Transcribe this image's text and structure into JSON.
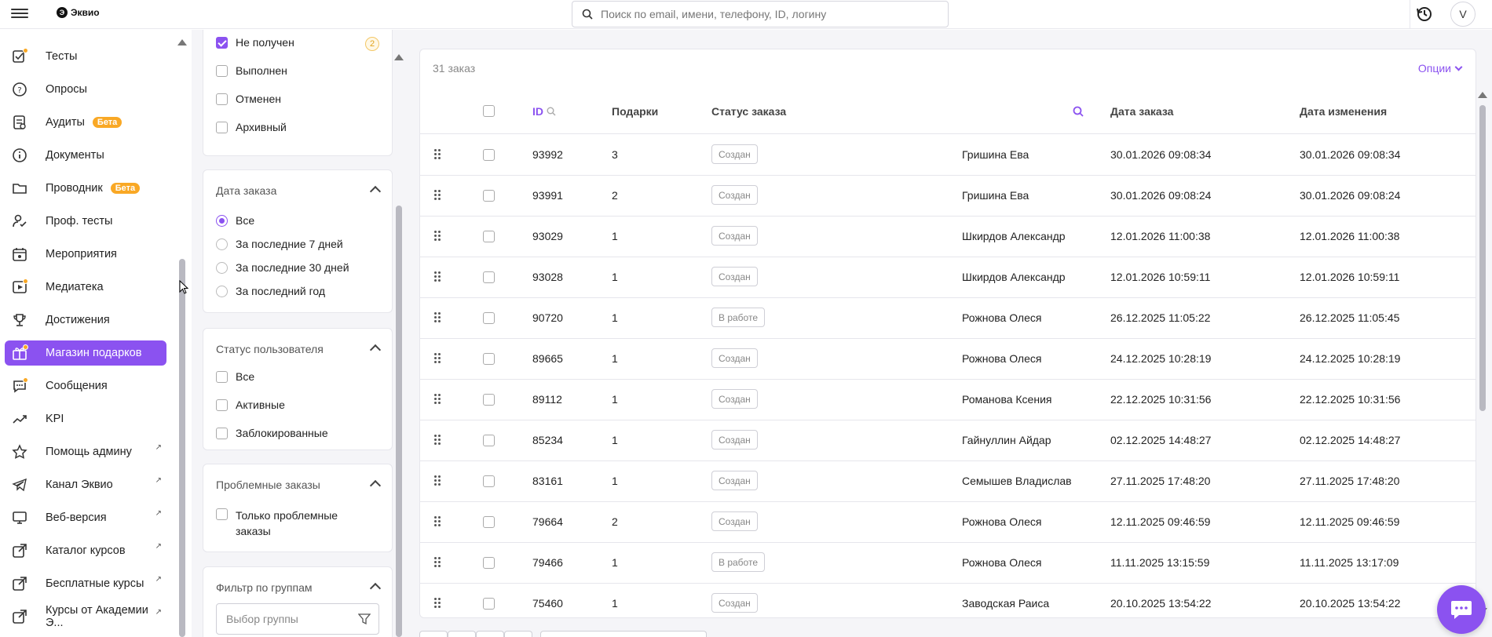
{
  "header": {
    "logo_text": "Эквио",
    "search_placeholder": "Поиск по email, имени, телефону, ID, логину",
    "avatar_letter": "V"
  },
  "sidebar": {
    "items": [
      {
        "label": "Тесты",
        "icon": "test-check-icon",
        "dot": true
      },
      {
        "label": "Опросы",
        "icon": "question-bubble-icon"
      },
      {
        "label": "Аудиты",
        "icon": "audit-clipboard-icon",
        "badge": "Бета"
      },
      {
        "label": "Документы",
        "icon": "info-circle-icon"
      },
      {
        "label": "Проводник",
        "icon": "folder-icon",
        "badge": "Бета"
      },
      {
        "label": "Проф. тесты",
        "icon": "user-check-icon"
      },
      {
        "label": "Мероприятия",
        "icon": "calendar-star-icon"
      },
      {
        "label": "Медиатека",
        "icon": "media-play-icon",
        "dot": true
      },
      {
        "label": "Достижения",
        "icon": "trophy-icon"
      },
      {
        "label": "Магазин подарков",
        "icon": "gift-icon",
        "active": true,
        "dot": true
      },
      {
        "label": "Сообщения",
        "icon": "chat-dots-icon",
        "dot": true
      },
      {
        "label": "KPI",
        "icon": "trend-up-icon"
      },
      {
        "label": "Помощь админу",
        "icon": "star-icon",
        "external": true
      },
      {
        "label": "Канал Эквио",
        "icon": "telegram-icon",
        "external": true
      },
      {
        "label": "Веб-версия",
        "icon": "monitor-icon",
        "external": true
      },
      {
        "label": "Каталог курсов",
        "icon": "external-link-icon",
        "external": true
      },
      {
        "label": "Бесплатные курсы",
        "icon": "external-link-icon",
        "external": true
      },
      {
        "label": "Курсы от Академии Э...",
        "icon": "external-link-icon",
        "external": true
      }
    ]
  },
  "filters": {
    "order_status": {
      "options": [
        {
          "label": "Не получен",
          "checked": true,
          "count": "2"
        },
        {
          "label": "Выполнен",
          "checked": false
        },
        {
          "label": "Отменен",
          "checked": false
        },
        {
          "label": "Архивный",
          "checked": false
        }
      ]
    },
    "order_date": {
      "title": "Дата заказа",
      "options": [
        {
          "label": "Все",
          "checked": true
        },
        {
          "label": "За последние 7 дней",
          "checked": false
        },
        {
          "label": "За последние 30 дней",
          "checked": false
        },
        {
          "label": "За последний год",
          "checked": false
        }
      ]
    },
    "user_status": {
      "title": "Статус пользователя",
      "options": [
        {
          "label": "Все",
          "checked": false
        },
        {
          "label": "Активные",
          "checked": false
        },
        {
          "label": "Заблокированные",
          "checked": false
        }
      ]
    },
    "problem_orders": {
      "title": "Проблемные заказы",
      "option_line1": "Только проблемные",
      "option_line2": "заказы"
    },
    "group_filter": {
      "title": "Фильтр по группам",
      "placeholder": "Выбор группы"
    }
  },
  "table": {
    "count_label": "31 заказ",
    "options_label": "Опции",
    "columns": {
      "id": "ID",
      "gifts": "Подарки",
      "status": "Статус заказа",
      "order_date": "Дата заказа",
      "modified_date": "Дата изменения"
    },
    "rows": [
      {
        "id": "93992",
        "gifts": "3",
        "status": "Создан",
        "user": "Гришина Ева",
        "order_date": "30.01.2026 09:08:34",
        "modified": "30.01.2026 09:08:34"
      },
      {
        "id": "93991",
        "gifts": "2",
        "status": "Создан",
        "user": "Гришина Ева",
        "order_date": "30.01.2026 09:08:24",
        "modified": "30.01.2026 09:08:24"
      },
      {
        "id": "93029",
        "gifts": "1",
        "status": "Создан",
        "user": "Шкирдов Александр",
        "order_date": "12.01.2026 11:00:38",
        "modified": "12.01.2026 11:00:38"
      },
      {
        "id": "93028",
        "gifts": "1",
        "status": "Создан",
        "user": "Шкирдов Александр",
        "order_date": "12.01.2026 10:59:11",
        "modified": "12.01.2026 10:59:11"
      },
      {
        "id": "90720",
        "gifts": "1",
        "status": "В работе",
        "user": "Рожнова Олеся",
        "order_date": "26.12.2025 11:05:22",
        "modified": "26.12.2025 11:05:45"
      },
      {
        "id": "89665",
        "gifts": "1",
        "status": "Создан",
        "user": "Рожнова Олеся",
        "order_date": "24.12.2025 10:28:19",
        "modified": "24.12.2025 10:28:19"
      },
      {
        "id": "89112",
        "gifts": "1",
        "status": "Создан",
        "user": "Романова Ксения",
        "order_date": "22.12.2025 10:31:56",
        "modified": "22.12.2025 10:31:56"
      },
      {
        "id": "85234",
        "gifts": "1",
        "status": "Создан",
        "user": "Гайнуллин Айдар",
        "order_date": "02.12.2025 14:48:27",
        "modified": "02.12.2025 14:48:27"
      },
      {
        "id": "83161",
        "gifts": "1",
        "status": "Создан",
        "user": "Семышев Владислав",
        "order_date": "27.11.2025 17:48:20",
        "modified": "27.11.2025 17:48:20"
      },
      {
        "id": "79664",
        "gifts": "2",
        "status": "Создан",
        "user": "Рожнова Олеся",
        "order_date": "12.11.2025 09:46:59",
        "modified": "12.11.2025 09:46:59"
      },
      {
        "id": "79466",
        "gifts": "1",
        "status": "В работе",
        "user": "Рожнова Олеся",
        "order_date": "11.11.2025 13:15:59",
        "modified": "11.11.2025 13:17:09"
      },
      {
        "id": "75460",
        "gifts": "1",
        "status": "Создан",
        "user": "Заводская Раиса",
        "order_date": "20.10.2025 13:54:22",
        "modified": "20.10.2025 13:54:22"
      }
    ]
  },
  "colors": {
    "accent": "#8b52f0",
    "badge": "#f9a825"
  }
}
